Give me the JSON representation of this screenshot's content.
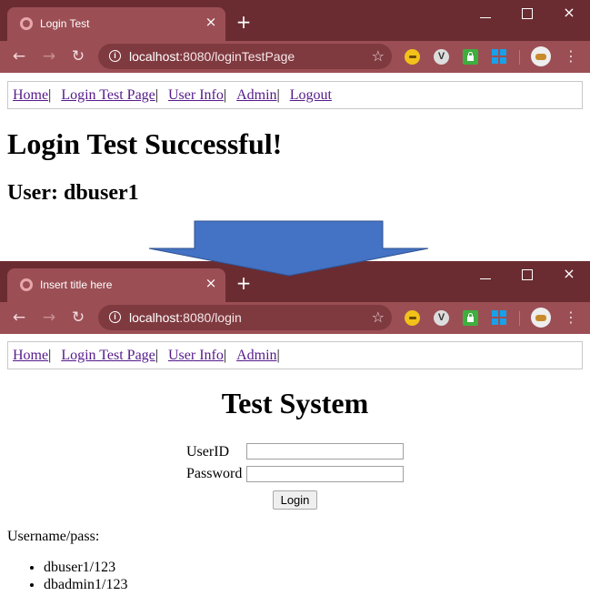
{
  "window1": {
    "tab_title": "Login Test",
    "url_host": "localhost",
    "url_rest": ":8080/loginTestPage",
    "nav_links": [
      "Home",
      "Login Test Page",
      "User Info",
      "Admin",
      "Logout"
    ],
    "separator": "|",
    "heading": "Login Test Successful!",
    "subheading": "User: dbuser1"
  },
  "window2": {
    "tab_title": "Insert title here",
    "url_host": "localhost",
    "url_rest": ":8080/login",
    "nav_links": [
      "Home",
      "Login Test Page",
      "User Info",
      "Admin"
    ],
    "separator": "|",
    "heading": "Test System",
    "userid_label": "UserID",
    "password_label": "Password",
    "userid_value": "",
    "password_value": "",
    "login_button": "Login",
    "credentials_label": "Username/pass:",
    "credentials": [
      "dbuser1/123",
      "dbadmin1/123"
    ]
  },
  "icons": {
    "close": "×",
    "new_tab": "+",
    "back": "←",
    "forward": "→",
    "reload": "↻",
    "star": "☆",
    "menu": "⋮",
    "info": "i",
    "ext_v": "V"
  },
  "colors": {
    "titlebar": "#6b2c31",
    "toolbar": "#9b4f55",
    "link": "#551a8b",
    "arrow": "#4472c4"
  }
}
